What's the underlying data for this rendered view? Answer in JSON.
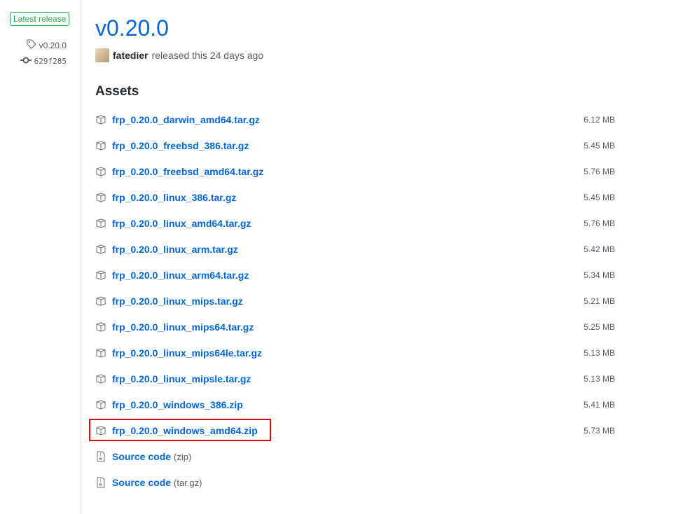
{
  "sidebar": {
    "badge": "Latest release",
    "tag": "v0.20.0",
    "commit": "629f285"
  },
  "release": {
    "title": "v0.20.0",
    "author": "fatedier",
    "released": "released this 24 days ago"
  },
  "assets_heading": "Assets",
  "assets": [
    {
      "name": "frp_0.20.0_darwin_amd64.tar.gz",
      "size": "6.12 MB"
    },
    {
      "name": "frp_0.20.0_freebsd_386.tar.gz",
      "size": "5.45 MB"
    },
    {
      "name": "frp_0.20.0_freebsd_amd64.tar.gz",
      "size": "5.76 MB"
    },
    {
      "name": "frp_0.20.0_linux_386.tar.gz",
      "size": "5.45 MB"
    },
    {
      "name": "frp_0.20.0_linux_amd64.tar.gz",
      "size": "5.76 MB"
    },
    {
      "name": "frp_0.20.0_linux_arm.tar.gz",
      "size": "5.42 MB"
    },
    {
      "name": "frp_0.20.0_linux_arm64.tar.gz",
      "size": "5.34 MB"
    },
    {
      "name": "frp_0.20.0_linux_mips.tar.gz",
      "size": "5.21 MB"
    },
    {
      "name": "frp_0.20.0_linux_mips64.tar.gz",
      "size": "5.25 MB"
    },
    {
      "name": "frp_0.20.0_linux_mips64le.tar.gz",
      "size": "5.13 MB"
    },
    {
      "name": "frp_0.20.0_linux_mipsle.tar.gz",
      "size": "5.13 MB"
    },
    {
      "name": "frp_0.20.0_windows_386.zip",
      "size": "5.41 MB"
    },
    {
      "name": "frp_0.20.0_windows_amd64.zip",
      "size": "5.73 MB"
    }
  ],
  "source": [
    {
      "label": "Source code",
      "fmt": "(zip)"
    },
    {
      "label": "Source code",
      "fmt": "(tar.gz)"
    }
  ]
}
